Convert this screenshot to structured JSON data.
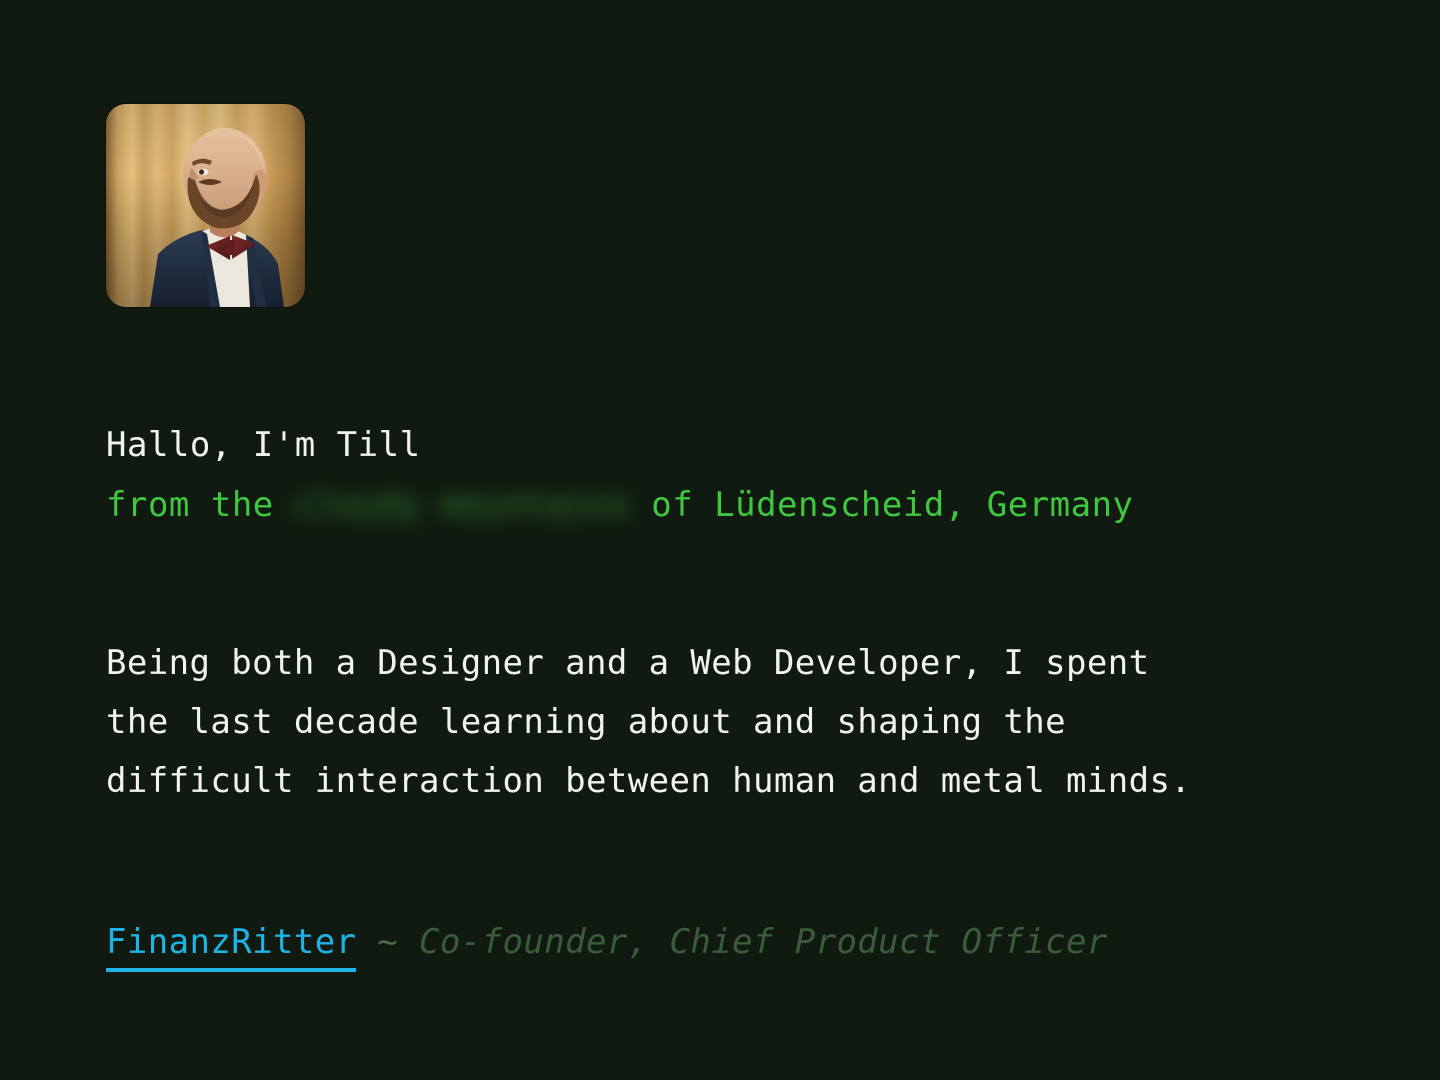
{
  "theme": {
    "background": "#111a11",
    "text_white": "#f3f3ee",
    "text_green": "#3fc83f",
    "text_green_muted": "#3b5c3b",
    "link_cyan": "#1fb4e6"
  },
  "avatar": {
    "alt": "Portrait photo of Till, a bearded man in a navy suit with a burgundy bow tie, in front of golden curtains"
  },
  "intro": {
    "greeting": "Hallo, I'm Till",
    "location_prefix": "from the ",
    "location_blurred": "cloudy mountains",
    "location_suffix": " of Lüdenscheid, Germany"
  },
  "bio": {
    "text": "Being both a Designer and a Web Developer, I spent\nthe last decade learning about and shaping the\ndifficult interaction between human and metal minds."
  },
  "role": {
    "company": "FinanzRitter",
    "separator": " ~ ",
    "title": "Co-founder, Chief Product Officer"
  }
}
